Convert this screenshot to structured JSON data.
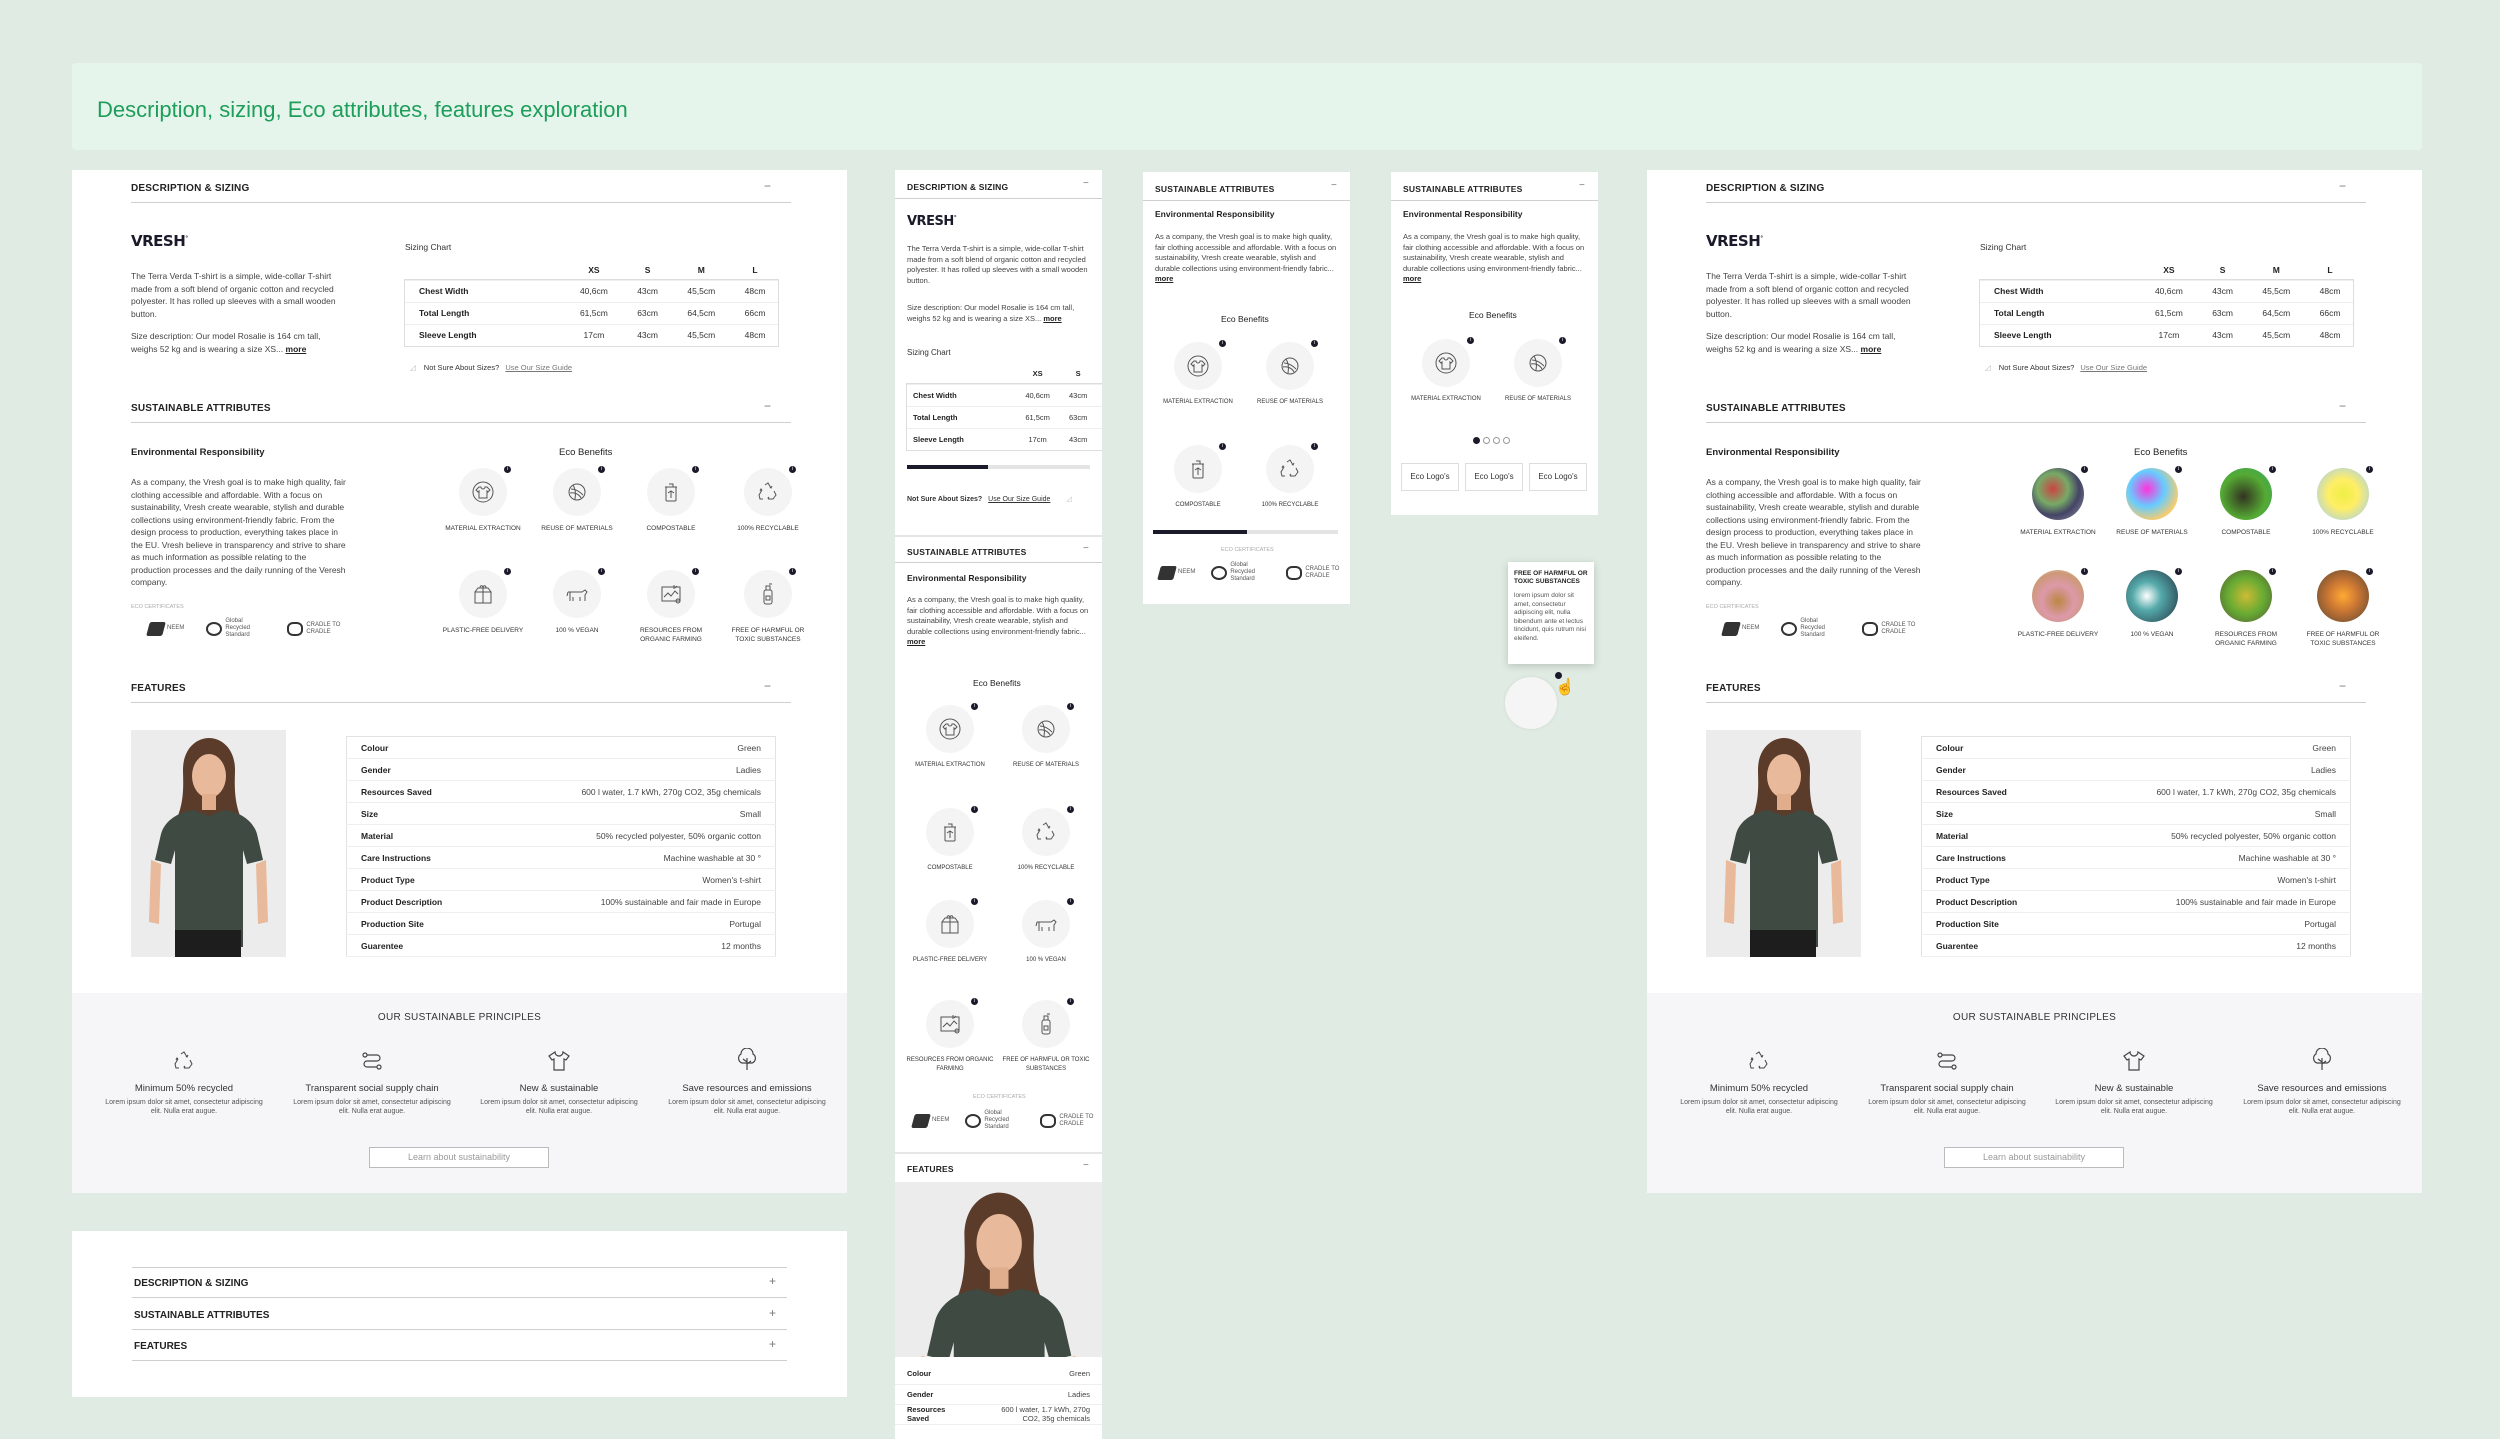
{
  "banner": {
    "title": "Description, sizing, Eco attributes, features exploration"
  },
  "brand": {
    "logo": "VRESH",
    "mark": "°"
  },
  "sections": {
    "description": "DESCRIPTION & SIZING",
    "sustainable": "SUSTAINABLE ATTRIBUTES",
    "features": "FEATURES",
    "collapse": "−",
    "expand": "+"
  },
  "description": {
    "text": "The Terra Verda T-shirt is a simple, wide-collar T-shirt made from a soft blend of organic cotton and recycled polyester. It has rolled up sleeves with a small wooden button.",
    "size_text": "Size description: Our model Rosalie is 164 cm tall, weighs 52 kg and is wearing a size XS...",
    "more": "more"
  },
  "sizing": {
    "title": "Sizing Chart",
    "columns": [
      "XS",
      "S",
      "M",
      "L"
    ],
    "rows": [
      {
        "label": "Chest Width",
        "values": [
          "40,6cm",
          "43cm",
          "45,5cm",
          "48cm"
        ]
      },
      {
        "label": "Total Length",
        "values": [
          "61,5cm",
          "63cm",
          "64,5cm",
          "66cm"
        ]
      },
      {
        "label": "Sleeve Length",
        "values": [
          "17cm",
          "43cm",
          "45,5cm",
          "48cm"
        ]
      }
    ],
    "not_sure": "Not Sure About Sizes?",
    "guide_link": "Use Our Size Guide"
  },
  "sustain": {
    "env_title": "Environmental Responsibility",
    "env_text": "As a company, the Vresh goal is to make high quality, fair clothing accessible and affordable. With a focus on sustainability, Vresh create wearable, stylish and durable collections using environment-friendly fabric. From the design process to production, everything takes place in the EU. Vresh believe in transparency and strive to share as much information as possible relating to the production processes and the daily running of the Veresh company.",
    "env_text_short": "As a company, the Vresh goal is to make high quality, fair clothing accessible and affordable. With a focus on sustainability, Vresh create wearable, stylish and durable collections using environment-friendly fabric...",
    "more": "more",
    "eco_title": "Eco Benefits",
    "benefits": [
      {
        "label": "MATERIAL EXTRACTION",
        "icon": "shirt-icon"
      },
      {
        "label": "REUSE OF MATERIALS",
        "icon": "yarn-icon"
      },
      {
        "label": "COMPOSTABLE",
        "icon": "compost-bin-icon"
      },
      {
        "label": "100% RECYCLABLE",
        "icon": "recycle-icon"
      },
      {
        "label": "PLASTIC-FREE DELIVERY",
        "icon": "box-icon"
      },
      {
        "label": "100 % VEGAN",
        "icon": "cow-icon"
      },
      {
        "label": "RESOURCES FROM ORGANIC FARMING",
        "icon": "farm-icon"
      },
      {
        "label": "FREE OF HARMFUL OR TOXIC SUBSTANCES",
        "icon": "bottle-icon"
      }
    ],
    "cert_label": "ECO CERTIFICATES",
    "certs": [
      "NEEM",
      "Global Recycled Standard",
      "CRADLE TO CRADLE"
    ],
    "logos": [
      "Eco Logo's",
      "Eco Logo's",
      "Eco Logo's"
    ],
    "tooltip_title": "FREE OF HARMFUL OR TOXIC SUBSTANCES",
    "tooltip_body": "lorem ipsum dolor sit amet, consectetur adipiscing elit, nulla bibendum ante et lectus tincidunt, quis rutrum nisi eleifend."
  },
  "features": {
    "rows": [
      {
        "k": "Colour",
        "v": "Green"
      },
      {
        "k": "Gender",
        "v": "Ladies"
      },
      {
        "k": "Resources Saved",
        "v": "600 l water, 1.7 kWh, 270g CO2, 35g chemicals"
      },
      {
        "k": "Size",
        "v": "Small"
      },
      {
        "k": "Material",
        "v": "50% recycled polyester, 50% organic cotton"
      },
      {
        "k": "Care Instructions",
        "v": "Machine washable at 30 °"
      },
      {
        "k": "Product Type",
        "v": "Women's t-shirt"
      },
      {
        "k": "Product Description",
        "v": "100% sustainable and fair made in Europe"
      },
      {
        "k": "Production Site",
        "v": "Portugal"
      },
      {
        "k": "Guarentee",
        "v": "12 months"
      }
    ],
    "mobile_rows": [
      {
        "k": "Colour",
        "v": "Green"
      },
      {
        "k": "Gender",
        "v": "Ladies"
      },
      {
        "k": "Resources Saved",
        "v": "600 l water, 1.7 kWh, 270g CO2, 35g chemicals"
      }
    ]
  },
  "principles": {
    "title": "OUR SUSTAINABLE PRINCIPLES",
    "items": [
      {
        "t": "Minimum 50% recycled",
        "icon": "recycle-icon"
      },
      {
        "t": "Transparent social supply chain",
        "icon": "route-icon"
      },
      {
        "t": "New & sustainable",
        "icon": "tshirt-icon"
      },
      {
        "t": "Save resources and emissions",
        "icon": "tree-icon"
      }
    ],
    "desc": "Lorem ipsum dolor sit amet, consectetur adipiscing elit. Nulla erat augue.",
    "button": "Learn about sustainability"
  },
  "colors": {
    "accent": "#1d9e5a",
    "dark": "#1a1a2a",
    "bg": "#e0ece3"
  }
}
